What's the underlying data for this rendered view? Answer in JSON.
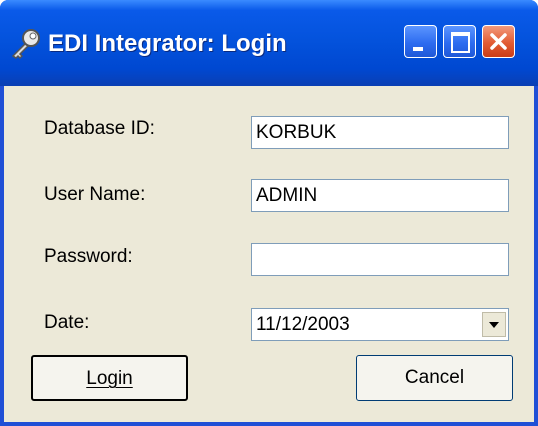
{
  "window": {
    "title": "EDI Integrator: Login",
    "icon": "key-icon"
  },
  "form": {
    "database_label": "Database ID:",
    "database_value": "KORBUK",
    "username_label": "User Name:",
    "username_value": "ADMIN",
    "password_label": "Password:",
    "password_value": "",
    "date_label": "Date:",
    "date_value": "11/12/2003"
  },
  "buttons": {
    "login": "Login",
    "cancel": "Cancel"
  },
  "colors": {
    "titlebar": "#0453dd",
    "close_button": "#e25b33",
    "dialog_bg": "#ece9d8"
  }
}
